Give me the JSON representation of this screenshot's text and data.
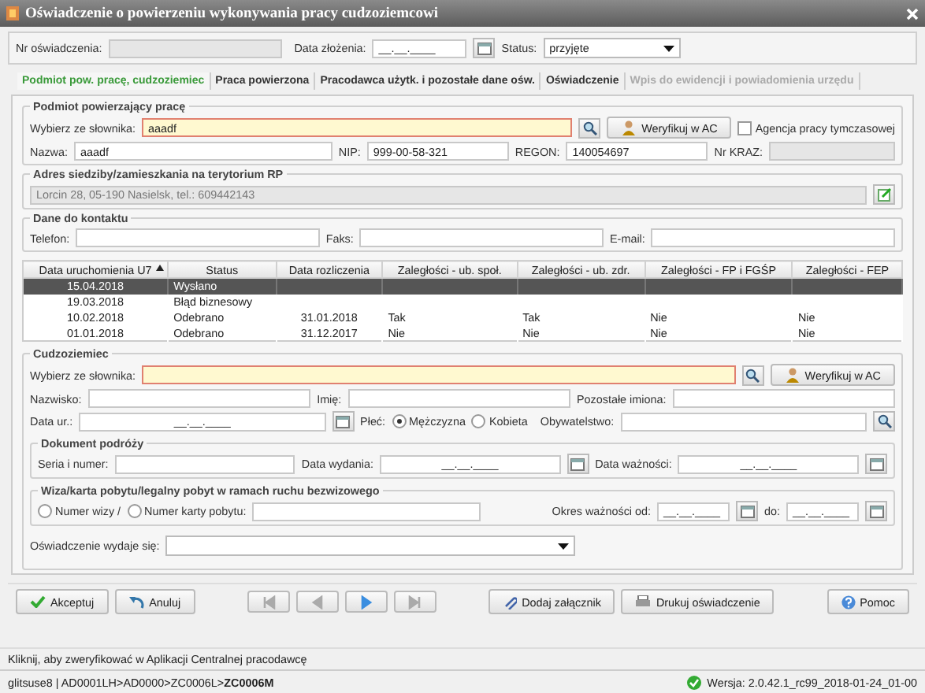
{
  "window": {
    "title": "Oświadczenie o powierzeniu wykonywania pracy cudzoziemcowi"
  },
  "header": {
    "number_label": "Nr oświadczenia:",
    "date_label": "Data złożenia:",
    "date_value": "__.__.____",
    "status_label": "Status:",
    "status_value": "przyjęte"
  },
  "tabs": [
    {
      "label": "Podmiot pow. pracę, cudzoziemiec",
      "selected": true,
      "disabled": false
    },
    {
      "label": "Praca powierzona",
      "selected": false,
      "disabled": false
    },
    {
      "label": "Pracodawca użytk. i pozostałe dane ośw.",
      "selected": false,
      "disabled": false
    },
    {
      "label": "Oświadczenie",
      "selected": false,
      "disabled": false
    },
    {
      "label": "Wpis do ewidencji i powiadomienia urzędu",
      "selected": false,
      "disabled": true
    }
  ],
  "employer": {
    "legend": "Podmiot powierzający pracę",
    "dict_label": "Wybierz ze słownika:",
    "dict_value": "aaadf",
    "verify_button": "Weryfikuj w AC",
    "agency": {
      "label": "Agencja pracy tymczasowej",
      "checked": false
    },
    "name_label": "Nazwa:",
    "name_value": "aaadf",
    "nip_label": "NIP:",
    "nip_value": "999-00-58-321",
    "regon_label": "REGON:",
    "regon_value": "140054697",
    "kraz_label": "Nr KRAZ:"
  },
  "address": {
    "legend": "Adres siedziby/zamieszkania na terytorium RP",
    "value": "Lorcin 28, 05-190 Nasielsk, tel.: 609442143"
  },
  "contact": {
    "legend": "Dane do kontaktu",
    "fields": [
      {
        "label": "Telefon:"
      },
      {
        "label": "Faks:"
      },
      {
        "label": "E-mail:"
      }
    ]
  },
  "table": {
    "columns": [
      {
        "label": "Data uruchomienia U7",
        "sorted": true
      },
      {
        "label": "Status",
        "sorted": false
      },
      {
        "label": "Data rozliczenia",
        "sorted": false
      },
      {
        "label": "Zaległości - ub. społ.",
        "sorted": false
      },
      {
        "label": "Zaległości - ub. zdr.",
        "sorted": false
      },
      {
        "label": "Zaległości - FP i FGŚP",
        "sorted": false
      },
      {
        "label": "Zaległości - FEP",
        "sorted": false
      }
    ],
    "rows": [
      {
        "selected": true,
        "started": "15.04.2018",
        "status": "Wysłano"
      },
      {
        "selected": false,
        "started": "19.03.2018",
        "status": "Błąd biznesowy"
      },
      {
        "selected": false,
        "started": "10.02.2018",
        "status": "Odebrano",
        "settled": "31.01.2018",
        "social": "Tak",
        "health": "Tak",
        "fp": "Nie",
        "fep": "Nie"
      },
      {
        "selected": false,
        "started": "01.01.2018",
        "status": "Odebrano",
        "settled": "31.12.2017",
        "social": "Nie",
        "health": "Nie",
        "fp": "Nie",
        "fep": "Nie"
      }
    ]
  },
  "foreigner": {
    "legend": "Cudzoziemiec",
    "dict_label": "Wybierz ze słownika:",
    "verify_button": "Weryfikuj w AC",
    "surname_label": "Nazwisko:",
    "name_label": "Imię:",
    "other_names_label": "Pozostałe imiona:",
    "birth_label": "Data ur.:",
    "birth_value": "__.__.____",
    "sex_label": "Płeć:",
    "sex_options": [
      {
        "label": "Mężczyzna",
        "selected": true
      },
      {
        "label": "Kobieta",
        "selected": false
      }
    ],
    "citizenship_label": "Obywatelstwo:"
  },
  "travel_document": {
    "legend": "Dokument podróży",
    "number_label": "Seria i numer:",
    "issue_label": "Data wydania:",
    "issue_value": "__.__.____",
    "expiry_label": "Data ważności:",
    "expiry_value": "__.__.____"
  },
  "visa": {
    "legend": "Wiza/karta pobytu/legalny pobyt w ramach ruchu bezwizowego",
    "options": [
      {
        "label": "Numer wizy /",
        "selected": false
      },
      {
        "label": "Numer karty pobytu:",
        "selected": false
      }
    ],
    "period_label": "Okres ważności od:",
    "from_value": "__.__.____",
    "to_label": "do:",
    "to_value": "__.__.____"
  },
  "issued": {
    "label": "Oświadczenie wydaje się:"
  },
  "buttons": {
    "accept": "Akceptuj",
    "cancel": "Anuluj",
    "attach": "Dodaj załącznik",
    "print": "Drukuj oświadczenie",
    "help": "Pomoc"
  },
  "nav": [
    {
      "kind": "first",
      "disabled": true
    },
    {
      "kind": "prev",
      "disabled": true
    },
    {
      "kind": "next",
      "disabled": false
    },
    {
      "kind": "last",
      "disabled": true
    }
  ],
  "hint": "Kliknij, aby zweryfikować w Aplikacji Centralnej pracodawcę",
  "status_bar": {
    "path": "glitsuse8 | AD0001LH>AD0000>ZC0006L>**ZC0006M**",
    "version": "Wersja: 2.0.42.1_rc99_2018-01-24_01-00"
  }
}
